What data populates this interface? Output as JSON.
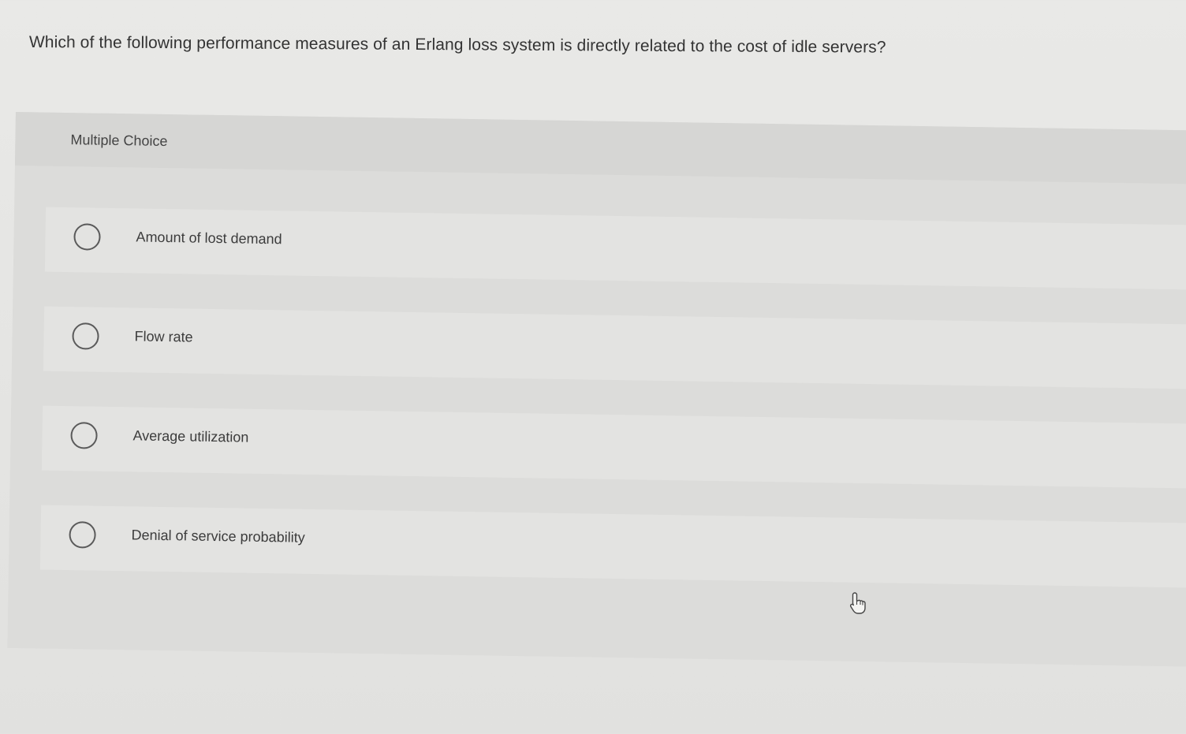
{
  "question": {
    "text": "Which of the following performance measures of an Erlang loss system is directly related to the cost of idle servers?"
  },
  "card": {
    "header_label": "Multiple Choice"
  },
  "options": [
    {
      "label": "Amount of lost demand",
      "selected": false
    },
    {
      "label": "Flow rate",
      "selected": false
    },
    {
      "label": "Average utilization",
      "selected": false
    },
    {
      "label": "Denial of service probability",
      "selected": false
    }
  ],
  "cursor": {
    "icon": "hand-pointer-icon"
  }
}
